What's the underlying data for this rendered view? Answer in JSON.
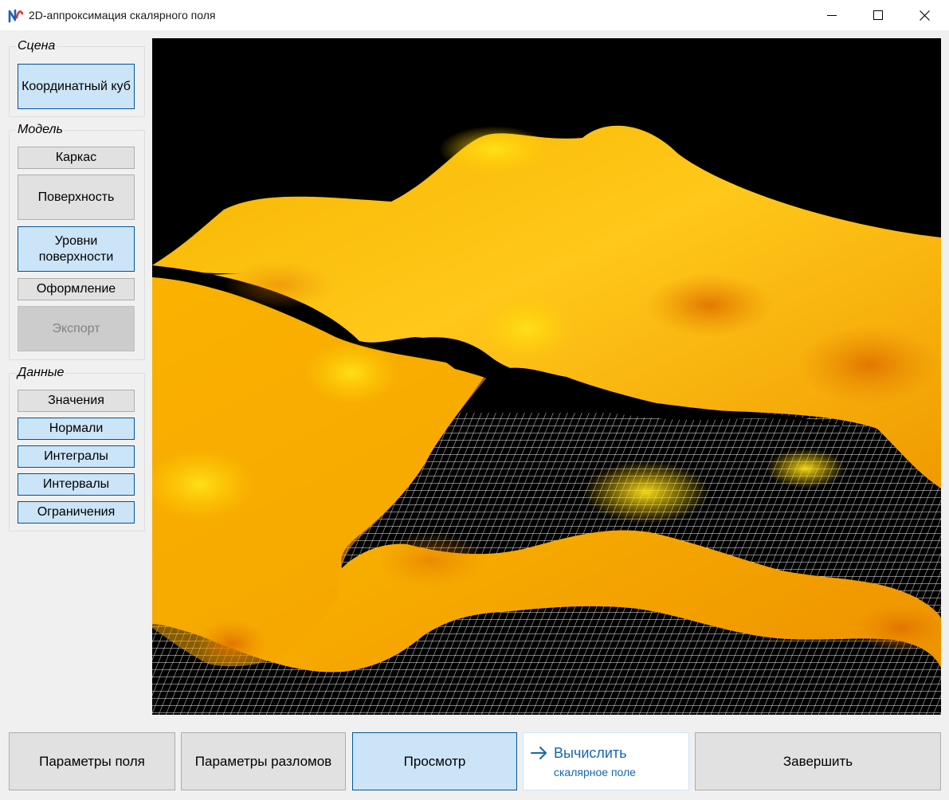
{
  "window": {
    "title": "2D-аппроксимация скалярного поля",
    "icon": "app-logo-icon"
  },
  "title_controls": {
    "minimize_icon": "minimize-icon",
    "maximize_icon": "maximize-icon",
    "close_icon": "close-icon"
  },
  "sidebar": {
    "scene": {
      "legend": "Сцена",
      "buttons": [
        {
          "label": "Координатный куб",
          "state": "active"
        }
      ]
    },
    "model": {
      "legend": "Модель",
      "buttons": [
        {
          "label": "Каркас",
          "state": "normal"
        },
        {
          "label": "Поверхность",
          "state": "normal"
        },
        {
          "label": "Уровни поверхности",
          "state": "active"
        },
        {
          "label": "Оформление",
          "state": "normal"
        },
        {
          "label": "Экспорт",
          "state": "disabled"
        }
      ]
    },
    "data": {
      "legend": "Данные",
      "buttons": [
        {
          "label": "Значения",
          "state": "normal"
        },
        {
          "label": "Нормали",
          "state": "active"
        },
        {
          "label": "Интегралы",
          "state": "active"
        },
        {
          "label": "Интервалы",
          "state": "active"
        },
        {
          "label": "Ограничения",
          "state": "active"
        }
      ]
    }
  },
  "viewport": {
    "content": "3D scalar field surface with fault gap over wireframe grid",
    "colors": {
      "background": "#000000",
      "surface_light": "#ffd21f",
      "surface_mid": "#f5a800",
      "surface_dark": "#e98a00",
      "grid": "#ffffff"
    }
  },
  "bottom_bar": {
    "field_params": "Параметры поля",
    "fault_params": "Параметры разломов",
    "preview": "Просмотр",
    "compute": {
      "title": "Вычислить",
      "subtitle": "скалярное поле",
      "icon": "arrow-right-icon"
    },
    "finish": "Завершить"
  }
}
